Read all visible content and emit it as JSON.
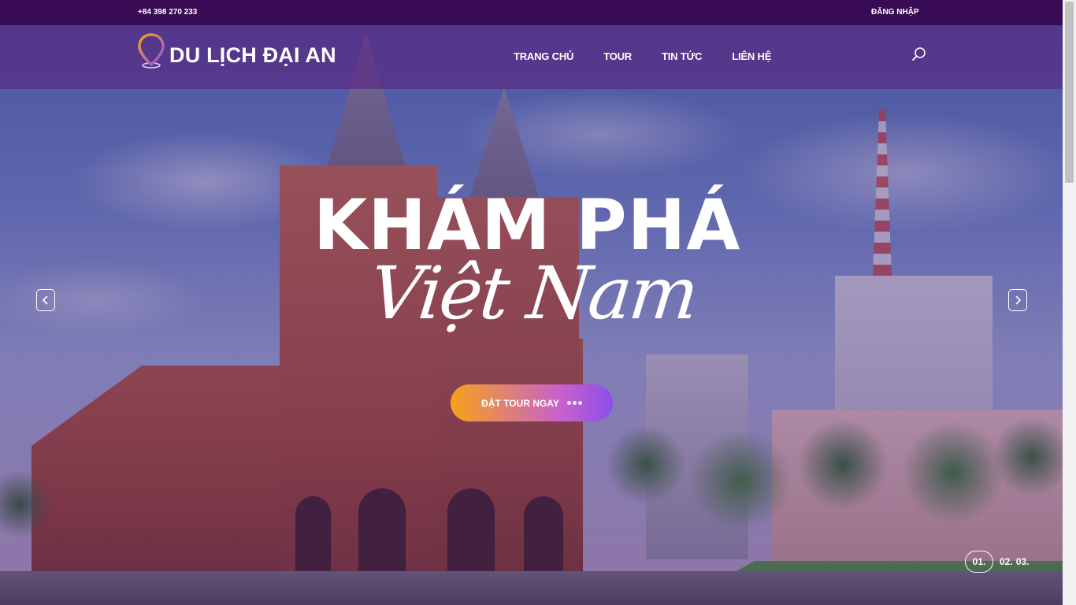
{
  "topbar": {
    "phone": "+84 398 270 233",
    "login_label": "ĐĂNG NHẬP"
  },
  "brand": {
    "name": "DU LỊCH ĐẠI AN",
    "logo_icon": "map-pin-icon",
    "logo_colors": [
      "#f7a21b",
      "#8a4fe8"
    ]
  },
  "nav": {
    "items": [
      {
        "label": "TRANG CHỦ"
      },
      {
        "label": "TOUR"
      },
      {
        "label": "TIN TỨC"
      },
      {
        "label": "LIÊN HỆ"
      }
    ],
    "search_icon": "search-icon"
  },
  "hero": {
    "headline": "KHÁM PHÁ",
    "script": "Việt Nam",
    "cta_label": "ĐẶT TOUR NGAY",
    "prev_icon": "chevron-left-icon",
    "next_icon": "chevron-right-icon"
  },
  "pagination": {
    "pages": [
      "01.",
      "02.",
      "03."
    ],
    "active_index": 0
  },
  "colors": {
    "topbar_bg": "#3a0b55",
    "header_overlay": "#5a2882",
    "cta_gradient_start": "#f7a21b",
    "cta_gradient_end": "#8a4fe8"
  }
}
